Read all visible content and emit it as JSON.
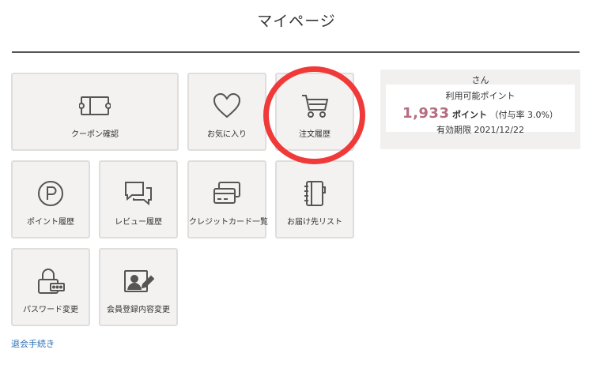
{
  "page": {
    "title": "マイページ"
  },
  "menu": [
    {
      "id": "coupon",
      "label": "クーポン確認",
      "icon": "coupon-icon"
    },
    {
      "id": "favorites",
      "label": "お気に入り",
      "icon": "heart-icon"
    },
    {
      "id": "orders",
      "label": "注文履歴",
      "icon": "cart-icon"
    },
    {
      "id": "points",
      "label": "ポイント履歴",
      "icon": "point-icon"
    },
    {
      "id": "reviews",
      "label": "レビュー履歴",
      "icon": "chat-icon"
    },
    {
      "id": "cards",
      "label": "クレジットカード一覧",
      "icon": "credit-card-icon"
    },
    {
      "id": "address",
      "label": "お届け先リスト",
      "icon": "address-book-icon"
    },
    {
      "id": "password",
      "label": "パスワード変更",
      "icon": "lock-icon"
    },
    {
      "id": "profile",
      "label": "会員登録内容変更",
      "icon": "profile-edit-icon"
    }
  ],
  "points_box": {
    "user_suffix": "さん",
    "available_label": "利用可能ポイント",
    "points_value": "1,933",
    "points_unit": "ポイント",
    "rate_text": "（付与率 3.0%）",
    "expiry_text": "有効期限 2021/12/22"
  },
  "footer": {
    "withdraw_link": "退会手続き"
  },
  "colors": {
    "accent_points": "#b56d7f",
    "highlight": "#f03a3a",
    "link": "#2a6fb8"
  }
}
